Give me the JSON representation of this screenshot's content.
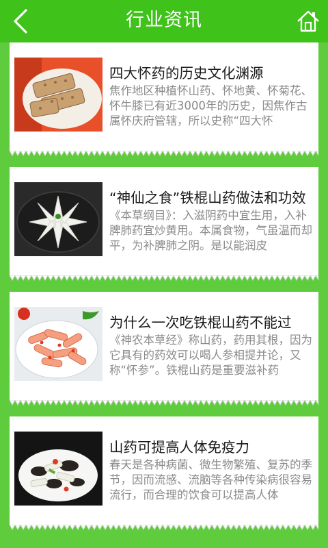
{
  "header": {
    "title": "行业资讯",
    "back_icon": "chevron-left-icon",
    "home_icon": "home-icon",
    "bg_color": "#3fc21a"
  },
  "articles": [
    {
      "title": "四大怀药的历史文化渊源",
      "summary": "焦作地区种植怀山药、怀地黄、怀菊花、怀牛膝已有近3000年的历史，因焦作古属怀庆府管辖，所以史称“四大怀"
    },
    {
      "title": "“神仙之食”铁棍山药做法和功效",
      "summary": "《本草纲目》：入滋阴药中宜生用，入补脾肺药宜炒黄用。本属食物，气虽温而却平，为补脾肺之阴。是以能润皮"
    },
    {
      "title": "为什么一次吃铁棍山药不能过",
      "summary": "《神农本草经》称山药，药用其根，因为它具有的药效可以喝人参相提并论，又称“怀参”。铁棍山药是重要滋补药"
    },
    {
      "title": "山药可提高人体免疫力",
      "summary": "春天是各种病菌、微生物繁殖、复苏的季节，因而流感、流脑等各种传染病很容易流行，而合理的饮食可以提高人体"
    }
  ]
}
